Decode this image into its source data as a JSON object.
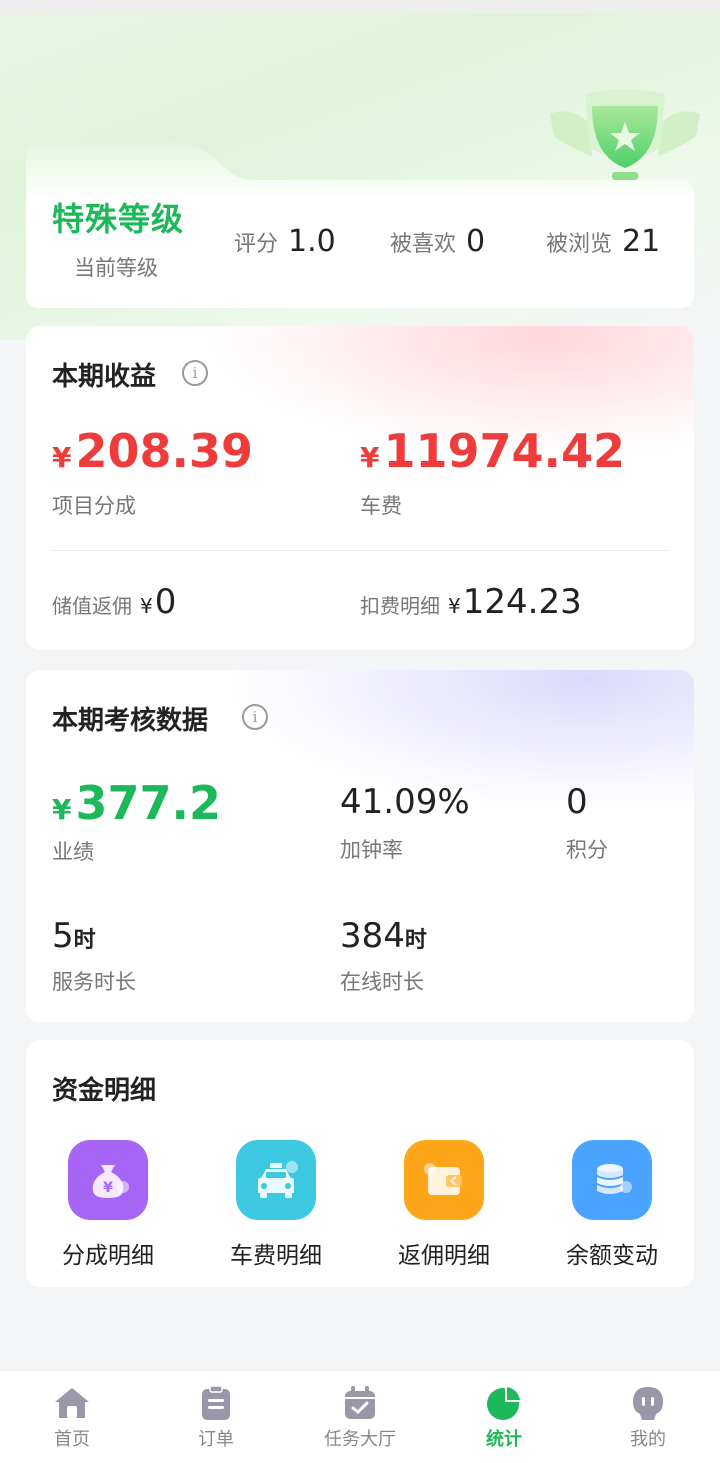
{
  "level": {
    "name": "特殊等级",
    "sub_label": "当前等级",
    "stats": [
      {
        "label": "评分",
        "value": "1.0"
      },
      {
        "label": "被喜欢",
        "value": "0"
      },
      {
        "label": "被浏览",
        "value": "21"
      }
    ]
  },
  "income": {
    "title": "本期收益",
    "info": "i",
    "currency": "¥",
    "items": [
      {
        "value": "208.39",
        "label": "项目分成"
      },
      {
        "value": "11974.42",
        "label": "车费"
      }
    ],
    "small": [
      {
        "label": "储值返佣",
        "value": "0"
      },
      {
        "label": "扣费明细",
        "value": "124.23"
      }
    ]
  },
  "assessment": {
    "title": "本期考核数据",
    "info": "i",
    "currency": "¥",
    "performance": {
      "value": "377.2",
      "label": "业绩"
    },
    "overtime_rate": {
      "value": "41.09%",
      "label": "加钟率"
    },
    "points": {
      "value": "0",
      "label": "积分"
    },
    "service_hours": {
      "value": "5",
      "unit": "时",
      "label": "服务时长"
    },
    "online_hours": {
      "value": "384",
      "unit": "时",
      "label": "在线时长"
    }
  },
  "funds": {
    "title": "资金明细",
    "items": [
      {
        "label": "分成明细",
        "icon": "money-bag-icon",
        "color": "#a765f5"
      },
      {
        "label": "车费明细",
        "icon": "taxi-icon",
        "color": "#3cc8e0"
      },
      {
        "label": "返佣明细",
        "icon": "wallet-icon",
        "color": "#ffa51a"
      },
      {
        "label": "余额变动",
        "icon": "coin-stack-icon",
        "color": "#4aa3ff"
      }
    ]
  },
  "nav": {
    "items": [
      {
        "label": "首页",
        "icon": "home-icon"
      },
      {
        "label": "订单",
        "icon": "order-icon"
      },
      {
        "label": "任务大厅",
        "icon": "calendar-icon"
      },
      {
        "label": "统计",
        "icon": "pie-chart-icon"
      },
      {
        "label": "我的",
        "icon": "user-icon"
      }
    ],
    "active": "统计"
  },
  "colors": {
    "accent_green": "#1cb85a",
    "money_red": "#ee3c3c"
  }
}
